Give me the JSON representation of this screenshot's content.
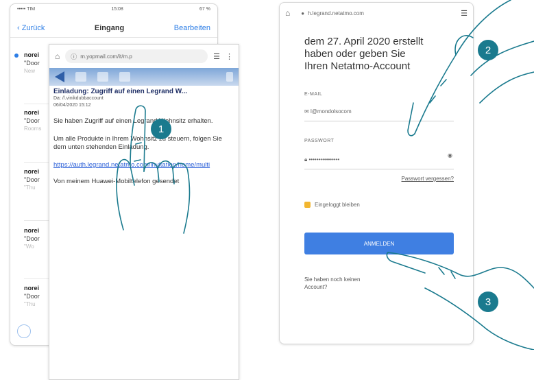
{
  "mail_app": {
    "status_left": "••••• TIM",
    "status_time": "15:08",
    "status_right": "67 %",
    "back_label": "Zurück",
    "title": "Eingang",
    "edit_label": "Bearbeiten",
    "rows": [
      {
        "from": "norei",
        "snippet": "\"Door",
        "sub": "New"
      },
      {
        "from": "norei",
        "snippet": "\"Door",
        "sub": "Rooms"
      },
      {
        "from": "norei",
        "snippet": "\"Door",
        "sub": "\"Thu"
      },
      {
        "from": "norei",
        "snippet": "\"Door",
        "sub": "\"Wo"
      },
      {
        "from": "norei",
        "snippet": "\"Door",
        "sub": "\"Thu"
      }
    ]
  },
  "email_view": {
    "url": "m.yopmail.com/it/m.p",
    "subject": "Einladung: Zugriff auf einen Legrand W...",
    "to_line": "Da: //.vinikdubbaccount",
    "date_line": "06/04/2020 15:12",
    "para1": "Sie haben Zugriff auf einen Legrand Wohnsitz erhalten.",
    "para2": "Um alle Produkte in Ihrem Wohnsitz zu steuern, folgen Sie dem unten stehenden Einladung.",
    "link": "https://auth.legrand.netatmo.com/invitation/home/multi",
    "signature": "Von meinem Huawei-Mobiltelefon gesendet"
  },
  "login_view": {
    "url": "h.legrand.netatmo.com",
    "intro_line1": "dem 27. April 2020 erstellt",
    "intro_line2": "haben oder geben Sie",
    "intro_line3": "Ihren Netatmo-Account",
    "email_label": "E-MAIL",
    "email_value": "l@mondolsocom",
    "password_label": "PASSWORT",
    "password_value": "••••••••••••••••",
    "forgot_link": "Passwort vergessen?",
    "stay_logged": "Eingeloggt bleiben",
    "login_button": "ANMELDEN",
    "no_account_1": "Sie haben noch keinen",
    "no_account_2": "Account?"
  },
  "badges": [
    "1",
    "2",
    "3"
  ],
  "colors": {
    "accent": "#1a7a8e",
    "button": "#3f7fe2",
    "link": "#2d7ee6"
  }
}
